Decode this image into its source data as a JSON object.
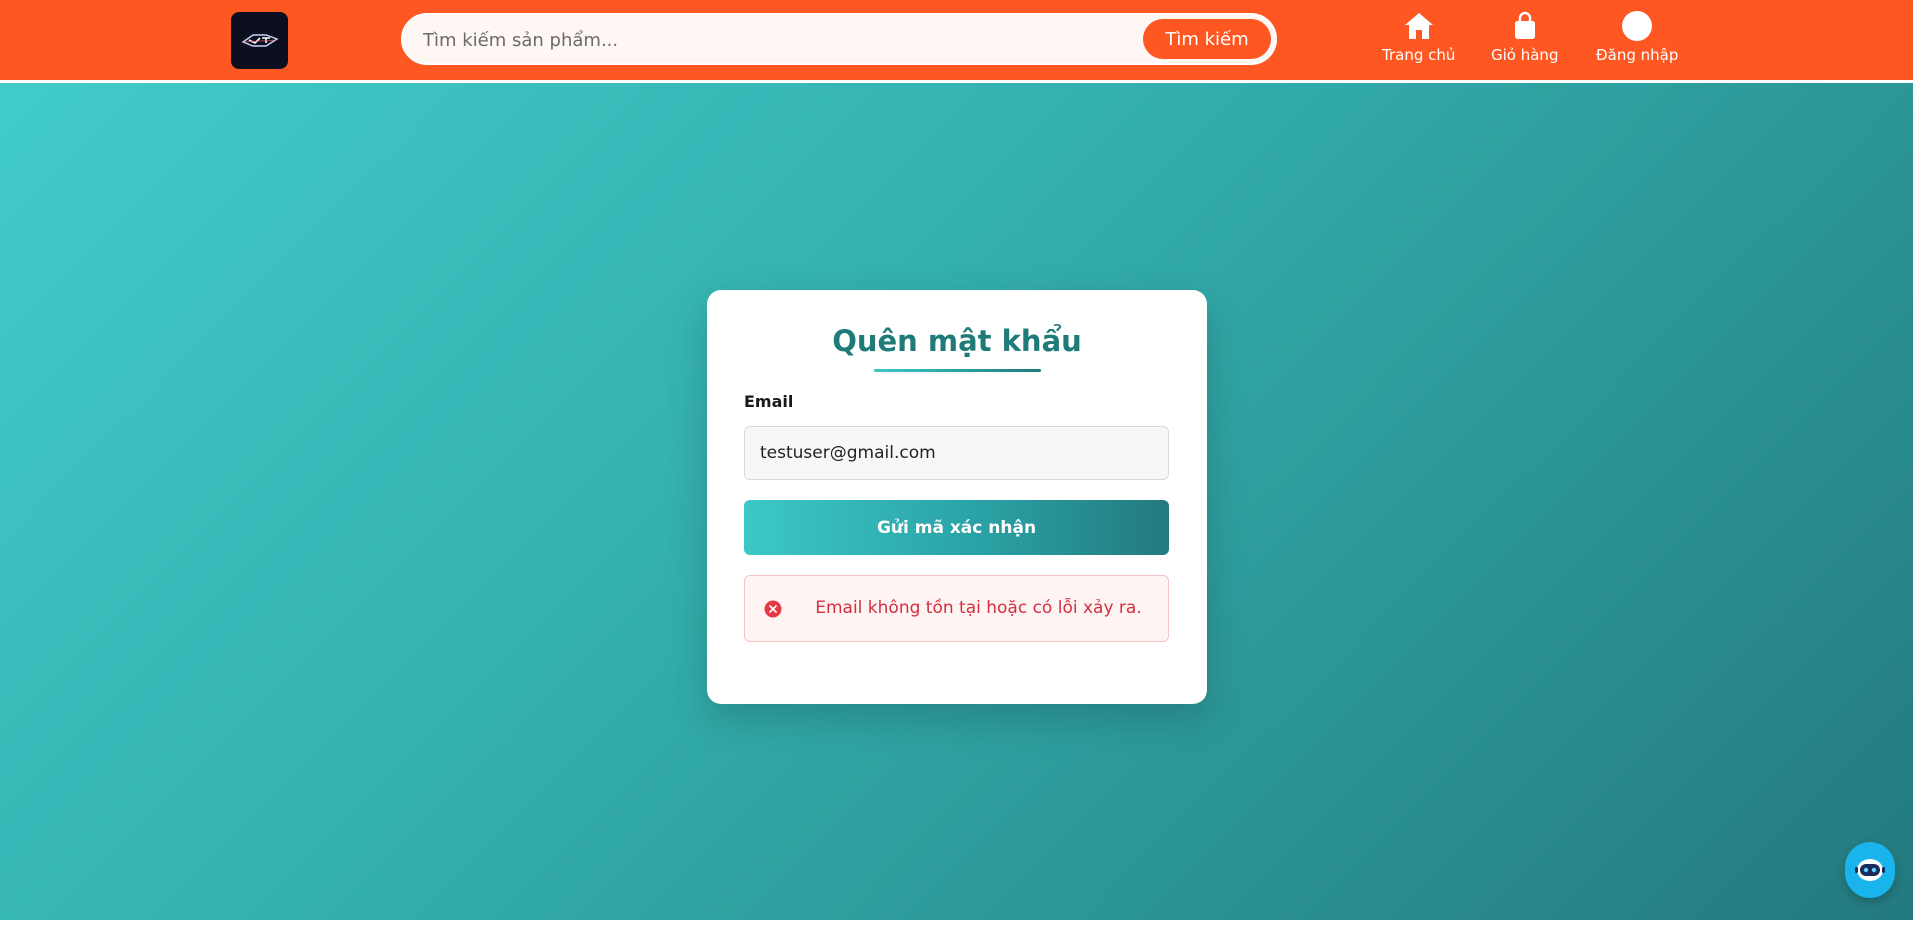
{
  "header": {
    "logo_text": "VDT",
    "search": {
      "placeholder": "Tìm kiếm sản phẩm...",
      "value": "",
      "button_label": "Tìm kiếm"
    },
    "nav": [
      {
        "label": "Trang chủ",
        "icon": "home-icon"
      },
      {
        "label": "Giỏ hàng",
        "icon": "shopping-bag-icon"
      },
      {
        "label": "Đăng nhập",
        "icon": "user-circle-icon"
      }
    ]
  },
  "form": {
    "title": "Quên mật khẩu",
    "email_label": "Email",
    "email_value": "testuser@gmail.com",
    "submit_label": "Gửi mã xác nhận",
    "error_message": "Email không tồn tại hoặc có lỗi xảy ra.",
    "error_icon": "error-circle-icon"
  },
  "chatbot": {
    "icon": "chatbot-icon"
  },
  "colors": {
    "header_bg": "#ff5722",
    "accent_teal": "#1e7b78",
    "error_red": "#d32f3f",
    "chat_blue": "#19b4ec"
  }
}
